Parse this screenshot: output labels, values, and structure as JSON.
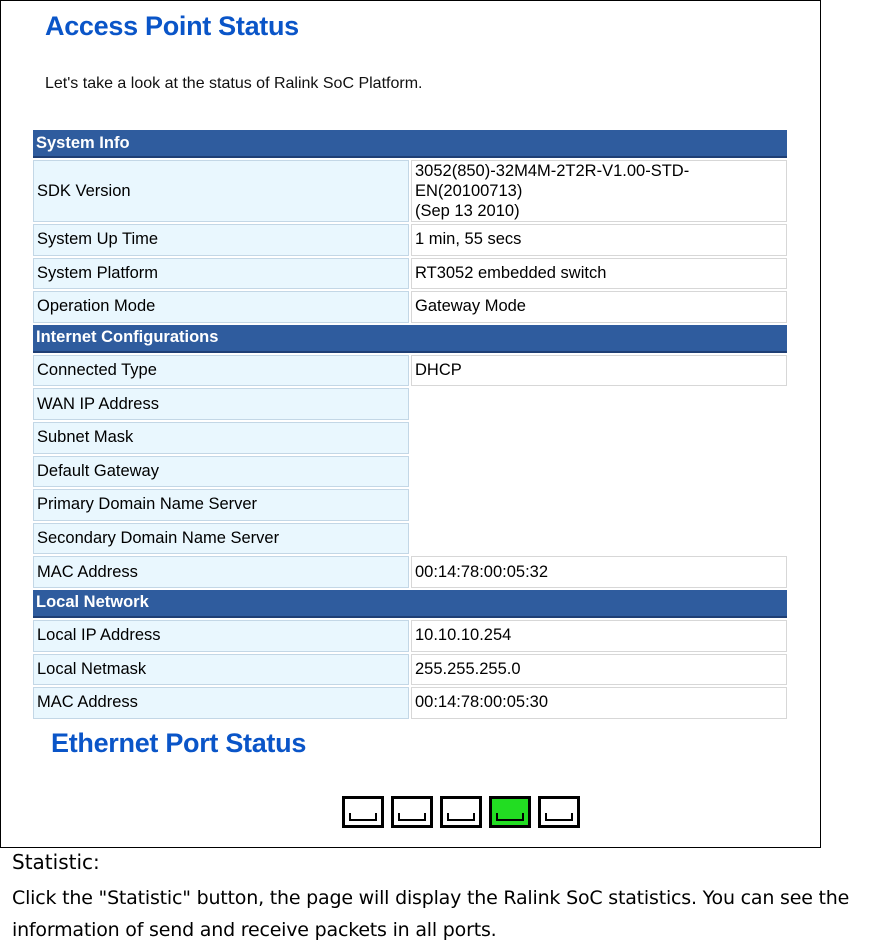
{
  "header": {
    "title": "Access Point Status",
    "subtitle": "Let's take a look at the status of Ralink SoC Platform."
  },
  "sections": {
    "system_info": {
      "title": "System Info",
      "rows": [
        {
          "label": "SDK Version",
          "value_line1": "3052(850)-32M4M-2T2R-V1.00-STD-EN(20100713)",
          "value_line2": "(Sep 13 2010)"
        },
        {
          "label": "System Up Time",
          "value": "1 min, 55 secs"
        },
        {
          "label": "System Platform",
          "value": "RT3052 embedded switch"
        },
        {
          "label": "Operation Mode",
          "value": "Gateway Mode"
        }
      ]
    },
    "internet": {
      "title": "Internet Configurations",
      "rows": [
        {
          "label": "Connected Type",
          "value": "DHCP"
        },
        {
          "label": "WAN IP Address",
          "value": ""
        },
        {
          "label": "Subnet Mask",
          "value": ""
        },
        {
          "label": "Default Gateway",
          "value": ""
        },
        {
          "label": "Primary Domain Name Server",
          "value": ""
        },
        {
          "label": "Secondary Domain Name Server",
          "value": ""
        },
        {
          "label": "MAC Address",
          "value": "00:14:78:00:05:32"
        }
      ]
    },
    "local": {
      "title": "Local Network",
      "rows": [
        {
          "label": "Local IP Address",
          "value": "10.10.10.254"
        },
        {
          "label": "Local Netmask",
          "value": "255.255.255.0"
        },
        {
          "label": "MAC Address",
          "value": "00:14:78:00:05:30"
        }
      ]
    }
  },
  "ethernet": {
    "title": "Ethernet Port Status",
    "ports": [
      {
        "icon": "ethernet-port-icon",
        "status": "disconnected"
      },
      {
        "icon": "ethernet-port-icon",
        "status": "disconnected"
      },
      {
        "icon": "ethernet-port-icon",
        "status": "disconnected"
      },
      {
        "icon": "ethernet-port-icon",
        "status": "connected"
      },
      {
        "icon": "ethernet-port-icon",
        "status": "disconnected"
      }
    ]
  },
  "doc": {
    "heading": "Statistic:",
    "body": "Click the \"Statistic\" button, the page will display the Ralink SoC statistics. You can see the information of send and receive packets in all ports."
  },
  "colors": {
    "title_blue": "#0a55c8",
    "section_header": "#2f5c9e",
    "label_bg": "#e9f7fe",
    "port_active": "#22dd22"
  }
}
